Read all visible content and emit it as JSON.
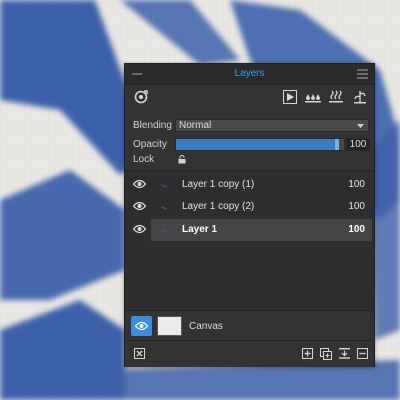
{
  "panel": {
    "title": "Layers",
    "blending_label": "Blending",
    "blending_value": "Normal",
    "opacity_label": "Opacity",
    "opacity_value": "100",
    "opacity_level": 0.97,
    "lock_label": "Lock"
  },
  "toolbar_icons": [
    "visibility-target-icon",
    "play-icon",
    "drops-icon",
    "steam-icon",
    "brush-tool-icon"
  ],
  "layers": [
    {
      "name": "Layer 1 copy (1)",
      "opacity": "100",
      "selected": false
    },
    {
      "name": "Layer 1 copy (2)",
      "opacity": "100",
      "selected": false
    },
    {
      "name": "Layer 1",
      "opacity": "100",
      "selected": true
    }
  ],
  "canvas_row": {
    "label": "Canvas"
  },
  "bottom_icons": [
    "clear-icon",
    "add-layer-icon",
    "duplicate-layer-icon",
    "merge-down-icon",
    "delete-layer-icon"
  ],
  "colors": {
    "accent": "#3d9be9",
    "panel_bg": "#333333",
    "paint": "#2f56a6"
  }
}
